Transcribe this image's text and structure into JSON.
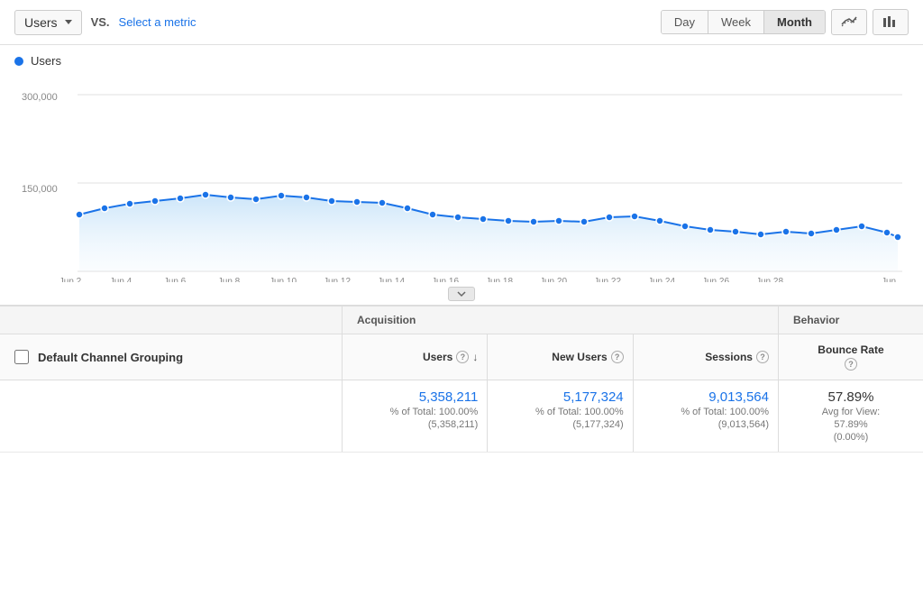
{
  "toolbar": {
    "metric_label": "Users",
    "vs_label": "VS.",
    "select_metric": "Select a metric",
    "time_buttons": [
      "Day",
      "Week",
      "Month"
    ],
    "active_time": "Month"
  },
  "chart": {
    "legend_label": "Users",
    "y_axis": [
      "300,000",
      "150,000"
    ],
    "x_axis": [
      "Jun 2",
      "Jun 4",
      "Jun 6",
      "Jun 8",
      "Jun 10",
      "Jun 12",
      "Jun 14",
      "Jun 16",
      "Jun 18",
      "Jun 20",
      "Jun 22",
      "Jun 24",
      "Jun 26",
      "Jun 28",
      "Jun"
    ]
  },
  "table": {
    "section_headers": {
      "acquisition": "Acquisition",
      "behavior": "Behavior"
    },
    "column_headers": {
      "channel": "Default Channel Grouping",
      "users": "Users",
      "new_users": "New Users",
      "sessions": "Sessions",
      "bounce_rate": "Bounce Rate"
    },
    "totals": {
      "users_value": "5,358,211",
      "users_pct": "% of Total: 100.00%",
      "users_abs": "(5,358,211)",
      "new_users_value": "5,177,324",
      "new_users_pct": "% of Total: 100.00%",
      "new_users_abs": "(5,177,324)",
      "sessions_value": "9,013,564",
      "sessions_pct": "% of Total: 100.00%",
      "sessions_abs": "(9,013,564)",
      "bounce_rate_value": "57.89%",
      "bounce_rate_avg": "Avg for View:",
      "bounce_rate_avg_val": "57.89%",
      "bounce_rate_diff": "(0.00%)"
    }
  }
}
